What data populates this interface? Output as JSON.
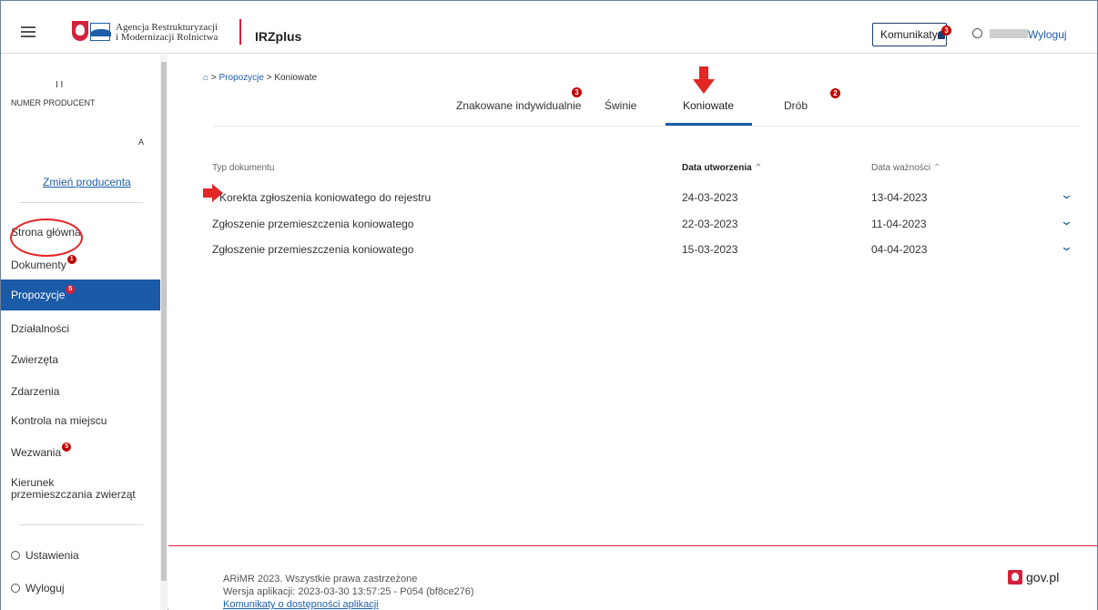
{
  "header": {
    "agency_line1": "Agencja Restrukturyzacji",
    "agency_line2": "i Modernizacji Rolnictwa",
    "app_name": "IRZplus",
    "komunikaty_label": "Komunikaty",
    "komunikaty_badge": "3",
    "logout_label": "Wyloguj"
  },
  "sidebar": {
    "producer_marks": "I          I",
    "producer_number_label": "NUMER PRODUCENTA:",
    "producer_suffix": "A",
    "change_producer": "Zmień producenta",
    "items": [
      {
        "label": "Strona główna",
        "badge": ""
      },
      {
        "label": "Dokumenty",
        "badge": "1"
      },
      {
        "label": "Propozycje",
        "badge": "5"
      },
      {
        "label": "Działalności",
        "badge": ""
      },
      {
        "label": "Zwierzęta",
        "badge": ""
      },
      {
        "label": "Zdarzenia",
        "badge": ""
      },
      {
        "label": "Kontrola na miejscu",
        "badge": ""
      },
      {
        "label": "Wezwania",
        "badge": "5"
      },
      {
        "label": "Kierunek przemieszczania zwierząt",
        "badge": ""
      }
    ],
    "settings": "Ustawienia",
    "logout": "Wyloguj"
  },
  "breadcrumb": {
    "sep": ">",
    "level1": "Propozycje",
    "level2": "Koniowate"
  },
  "tabs": [
    {
      "label": "Znakowane indywidualnie",
      "badge": "3"
    },
    {
      "label": "Świnie",
      "badge": ""
    },
    {
      "label": "Koniowate",
      "badge": ""
    },
    {
      "label": "Drób",
      "badge": "2"
    }
  ],
  "table": {
    "headers": [
      "Typ dokumentu",
      "Data utworzenia",
      "Data ważności"
    ],
    "rows": [
      {
        "type": "Korekta zgłoszenia koniowatego do rejestru",
        "created": "24-03-2023",
        "valid": "13-04-2023"
      },
      {
        "type": "Zgłoszenie przemieszczenia koniowatego",
        "created": "22-03-2023",
        "valid": "11-04-2023"
      },
      {
        "type": "Zgłoszenie przemieszczenia koniowatego",
        "created": "15-03-2023",
        "valid": "04-04-2023"
      }
    ]
  },
  "footer": {
    "copyright": "ARiMR 2023. Wszystkie prawa zastrzeżone",
    "version": "Wersja aplikacji: 2023-03-30 13:57:25 - P054 (bf8ce276)",
    "accessibility_link": "Komunikaty o dostępności aplikacji",
    "gov": "gov.pl"
  },
  "colors": {
    "primary": "#1a5aa6",
    "badge": "#c00000",
    "annotation": "#e32626"
  }
}
